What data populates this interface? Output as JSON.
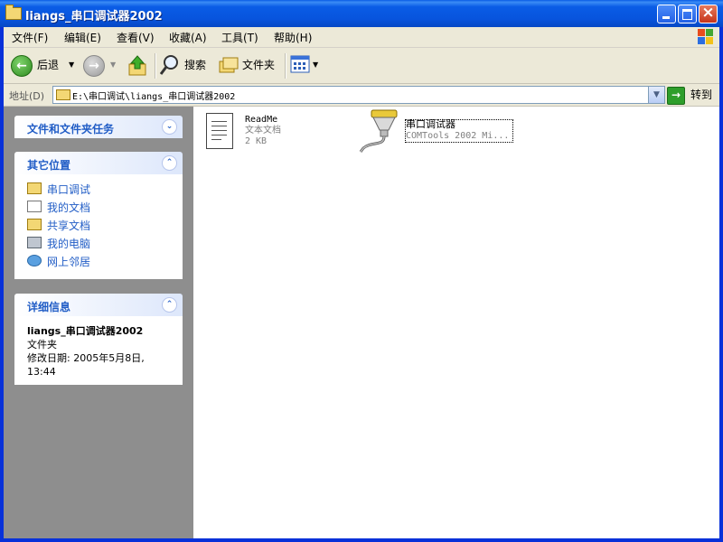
{
  "window": {
    "title": "liangs_串口调试器2002"
  },
  "menu": [
    "文件(F)",
    "编辑(E)",
    "查看(V)",
    "收藏(A)",
    "工具(T)",
    "帮助(H)"
  ],
  "toolbar": {
    "back_label": "后退",
    "search_label": "搜索",
    "folders_label": "文件夹"
  },
  "address": {
    "label": "地址(D)",
    "value": "E:\\串口调试\\liangs_串口调试器2002",
    "go_label": "转到"
  },
  "tasks": {
    "file_tasks_title": "文件和文件夹任务",
    "other_places_title": "其它位置",
    "other_places": [
      {
        "label": "串口调试",
        "icon": "folder-icon"
      },
      {
        "label": "我的文档",
        "icon": "documents-icon"
      },
      {
        "label": "共享文档",
        "icon": "folder-icon"
      },
      {
        "label": "我的电脑",
        "icon": "computer-icon"
      },
      {
        "label": "网上邻居",
        "icon": "network-icon"
      }
    ],
    "details_title": "详细信息",
    "details": {
      "name": "liangs_串口调试器2002",
      "type": "文件夹",
      "modified_line1": "修改日期: 2005年5月8日,",
      "modified_line2": "13:44"
    }
  },
  "files": [
    {
      "name": "ReadMe",
      "type": "文本文档",
      "size": "2 KB",
      "icon": "text-document-icon"
    },
    {
      "name": "串口调试器",
      "desc": "COMTools 2002 Mi...",
      "icon": "serial-port-icon"
    }
  ],
  "colors": {
    "titlebar": "#0a5ce6",
    "link": "#215dc6",
    "chrome": "#ece9d8"
  }
}
